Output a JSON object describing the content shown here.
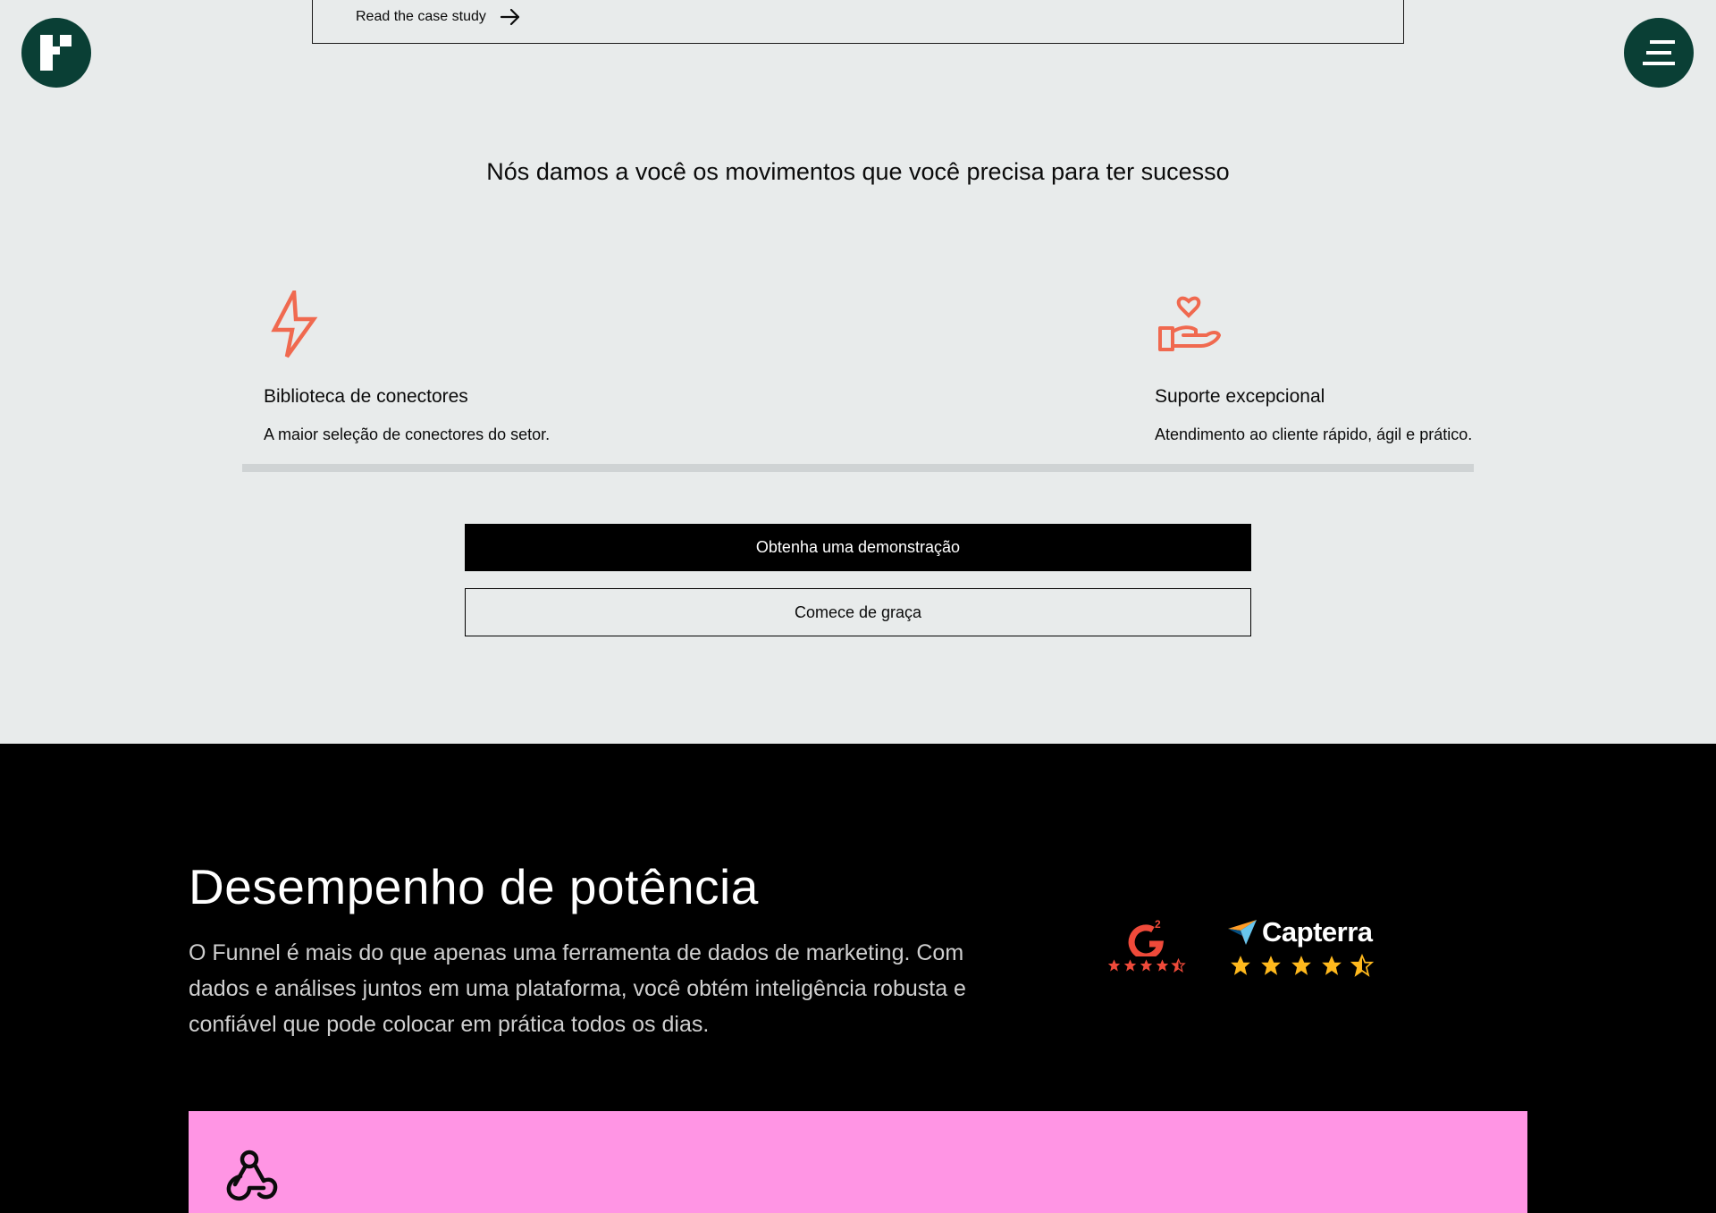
{
  "case_study": {
    "link_label": "Read the case study",
    "arrow_icon": "arrow-right-icon"
  },
  "header": {
    "logo_icon": "funnel-logo-icon",
    "menu_icon": "hamburger-menu-icon"
  },
  "features_section": {
    "heading": "Nós damos a você os movimentos que você precisa para ter sucesso",
    "accent_color": "#f0694f",
    "features": [
      {
        "icon": "lightning-bolt-icon",
        "title": "Biblioteca de conectores",
        "description": "A maior seleção de conectores do setor."
      },
      {
        "icon": "hand-heart-icon",
        "title": "Suporte excepcional",
        "description": "Atendimento ao cliente rápido, ágil e prático."
      }
    ]
  },
  "cta": {
    "primary_label": "Obtenha uma demonstração",
    "secondary_label": "Comece de graça"
  },
  "performance_section": {
    "title": "Desempenho de potência",
    "body": "O Funnel é mais do que apenas uma ferramenta de dados de marketing. Com dados e análises juntos em uma plataforma, você obtém inteligência robusta e confiável que pode colocar em prática todos os dias.",
    "ratings": [
      {
        "name": "G2",
        "stars": 4.5,
        "icon": "g2-logo-icon",
        "star_color": "#ef4a3a"
      },
      {
        "name": "Capterra",
        "stars": 4.5,
        "icon": "capterra-logo-icon",
        "star_color": "#ffb91d"
      }
    ],
    "card_color": "#ff95e4",
    "card_icon": "webhook-icon"
  }
}
